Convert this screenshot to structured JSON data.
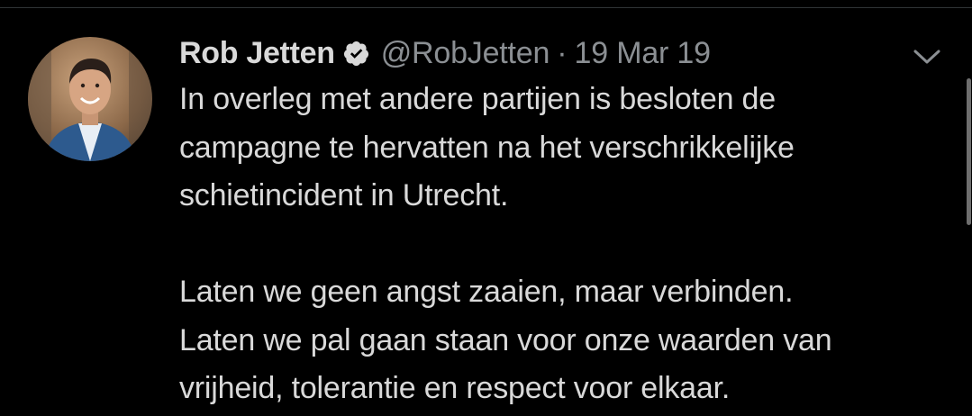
{
  "tweet": {
    "author": {
      "display_name": "Rob Jetten",
      "handle": "@RobJetten",
      "verified_icon": "verified-badge-icon"
    },
    "separator": "·",
    "date": "19 Mar 19",
    "menu_icon": "chevron-down-icon",
    "text": "In overleg met andere partijen is besloten de\ncampagne te hervatten na het verschrikkelijke\nschietincident in Utrecht.\n\nLaten we geen angst zaaien, maar verbinden.\nLaten we pal gaan staan voor onze waarden van\nvrijheid, tolerantie en respect voor elkaar."
  },
  "colors": {
    "background": "#000000",
    "text_primary": "#d9d9d9",
    "text_secondary": "#8b8f93",
    "divider": "#2f3336"
  }
}
